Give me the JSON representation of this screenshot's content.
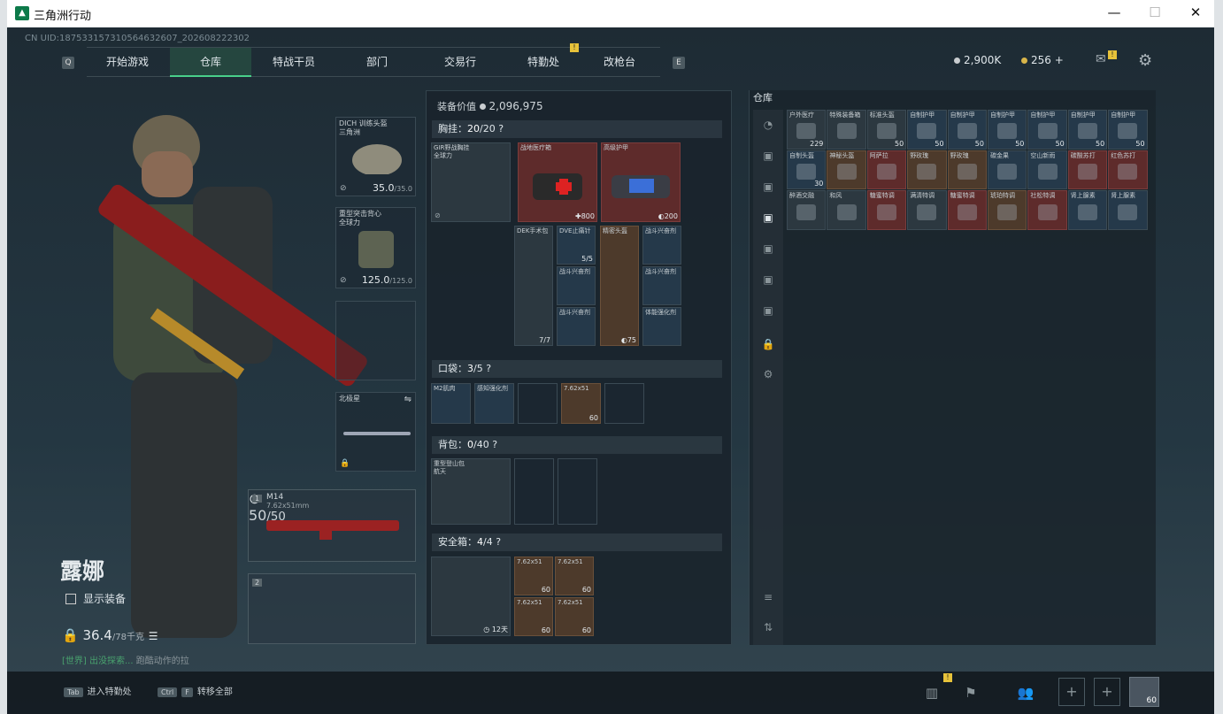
{
  "window": {
    "title": "三角洲行动"
  },
  "uid": "CN UID:187533157310564632607_202608222302",
  "nav": {
    "left_key": "Q",
    "right_key": "E",
    "tabs": [
      {
        "label": "开始游戏"
      },
      {
        "label": "仓库"
      },
      {
        "label": "特战干员"
      },
      {
        "label": "部门"
      },
      {
        "label": "交易行"
      },
      {
        "label": "特勤处"
      },
      {
        "label": "改枪台"
      }
    ],
    "active_tab": "仓库"
  },
  "currency": {
    "coins": "2,900K",
    "bonds": "256",
    "plus": "+"
  },
  "operator": {
    "name": "露娜",
    "show_equipment": "显示装备",
    "weight": "36.4",
    "weight_max": "/78千克"
  },
  "note": {
    "tag": "[世界]",
    "text": "出没探索...",
    "extra": "跑酷动作的拉"
  },
  "equipment": {
    "helmet": {
      "label": "DICH 训练头盔\n三角洲",
      "value": "35.0",
      "max": "/35.0"
    },
    "armor": {
      "label": "重型突击背心\n全球力",
      "value": "125.0",
      "max": "/125.0"
    },
    "melee": {
      "label": "北极星"
    },
    "primary": {
      "slot": "1",
      "name": "M14",
      "caliber": "7.62x51mm",
      "ammo": "50",
      "ammo_max": "/50"
    },
    "secondary": {
      "slot": "2"
    }
  },
  "loadout": {
    "value_label": "装备价值",
    "value": "2,096,975",
    "chest": {
      "label": "胸挂：",
      "count": "20",
      "max": "/20",
      "help": "?"
    },
    "pocket": {
      "label": "口袋：",
      "count": "3",
      "max": "/5",
      "help": "?"
    },
    "backpack": {
      "label": "背包：",
      "count": "0",
      "max": "/40",
      "help": "?"
    },
    "safe": {
      "label": "安全箱：",
      "count": "4",
      "max": "/4",
      "help": "?",
      "days": "12天"
    },
    "chest_items": [
      {
        "name": "GIR野战胸挂\n全球力",
        "count": ""
      },
      {
        "name": "战地医疗箱",
        "count": "800"
      },
      {
        "name": "高级护甲",
        "count": "200"
      },
      {
        "name": "DEK手术包",
        "count": "7/7"
      },
      {
        "name": "DVE止痛针",
        "count": "5/5"
      },
      {
        "name": "精密头盔",
        "count": "75"
      },
      {
        "name": "战斗兴奋剂",
        "count": ""
      },
      {
        "name": "战斗兴奋剂",
        "count": ""
      },
      {
        "name": "战斗兴奋剂",
        "count": ""
      },
      {
        "name": "战斗兴奋剂",
        "count": ""
      },
      {
        "name": "体能强化剂",
        "count": ""
      }
    ],
    "pocket_items": [
      {
        "name": "M2肌肉",
        "count": ""
      },
      {
        "name": "感知强化剂",
        "count": ""
      },
      {
        "name": "7.62x51",
        "count": "60"
      }
    ],
    "backpack_item": {
      "name": "重型登山包\n航天"
    },
    "safe_items": [
      {
        "name": "7.62x51",
        "count": "60"
      },
      {
        "name": "7.62x51",
        "count": "60"
      },
      {
        "name": "7.62x51",
        "count": "60"
      },
      {
        "name": "7.62x51",
        "count": "60"
      }
    ]
  },
  "warehouse": {
    "title": "仓库",
    "items": [
      {
        "name": "户外医疗",
        "count": "229",
        "cls": "gry"
      },
      {
        "name": "特殊装备箱",
        "count": "",
        "cls": "gry"
      },
      {
        "name": "标准头盔",
        "count": "50",
        "cls": "gry"
      },
      {
        "name": "自制护甲",
        "count": "50",
        "cls": "blu"
      },
      {
        "name": "自制护甲",
        "count": "50",
        "cls": "blu"
      },
      {
        "name": "自制护甲",
        "count": "50",
        "cls": "blu"
      },
      {
        "name": "自制护甲",
        "count": "50",
        "cls": "blu"
      },
      {
        "name": "自制护甲",
        "count": "50",
        "cls": "blu"
      },
      {
        "name": "自制护甲",
        "count": "50",
        "cls": "blu"
      },
      {
        "name": "自制头盔",
        "count": "30",
        "cls": "blu"
      },
      {
        "name": "神秘头盔",
        "count": "",
        "cls": "brn"
      },
      {
        "name": "阿萨拉",
        "count": "",
        "cls": "red"
      },
      {
        "name": "野玫瑰",
        "count": "",
        "cls": "brn"
      },
      {
        "name": "野玫瑰",
        "count": "",
        "cls": "brn"
      },
      {
        "name": "碳金果",
        "count": "",
        "cls": "blu"
      },
      {
        "name": "空山新雨",
        "count": "",
        "cls": "blu"
      },
      {
        "name": "碳酸苏打",
        "count": "",
        "cls": "red"
      },
      {
        "name": "红色苏打",
        "count": "",
        "cls": "red"
      },
      {
        "name": "醉酒交融",
        "count": "",
        "cls": "gry"
      },
      {
        "name": "和风",
        "count": "",
        "cls": "gry"
      },
      {
        "name": "糖蜜特调",
        "count": "",
        "cls": "red"
      },
      {
        "name": "满清特调",
        "count": "",
        "cls": "gry"
      },
      {
        "name": "糖蜜特调",
        "count": "",
        "cls": "red"
      },
      {
        "name": "琥珀特调",
        "count": "",
        "cls": "brn"
      },
      {
        "name": "社松特调",
        "count": "",
        "cls": "red"
      },
      {
        "name": "肾上腺素",
        "count": "",
        "cls": "blu"
      },
      {
        "name": "肾上腺素",
        "count": "",
        "cls": "blu"
      }
    ]
  },
  "bottom": {
    "tab_key": "Tab",
    "tab_label": "进入特勤处",
    "ctrl_key": "Ctrl",
    "f_key": "F",
    "ctrl_label": "转移全部",
    "level": "60"
  }
}
